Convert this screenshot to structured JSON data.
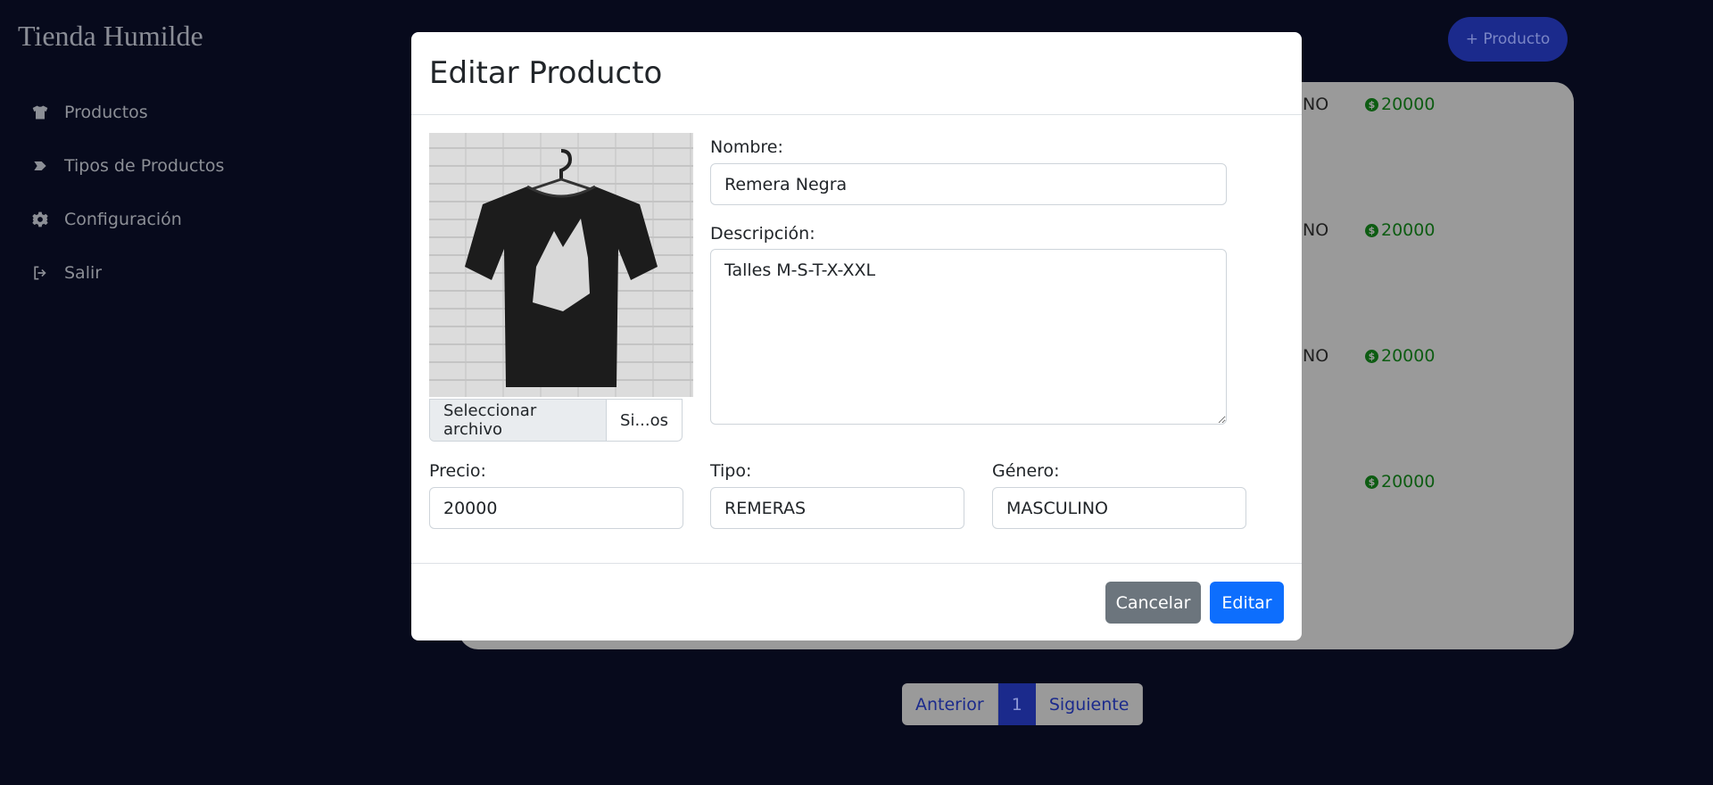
{
  "app": {
    "brand": "Tienda Humilde"
  },
  "sidebar": {
    "items": [
      {
        "label": "Productos",
        "icon": "tshirt-icon"
      },
      {
        "label": "Tipos de Productos",
        "icon": "tag-icon"
      },
      {
        "label": "Configuración",
        "icon": "gear-icon"
      },
      {
        "label": "Salir",
        "icon": "logout-icon"
      }
    ]
  },
  "header": {
    "add_product_label": "+ Producto"
  },
  "table": {
    "rows": [
      {
        "gender_fragment": "NO",
        "price": "20000"
      },
      {
        "gender_fragment": "NO",
        "price": "20000"
      },
      {
        "gender_fragment": "NO",
        "price": "20000"
      },
      {
        "gender_fragment": "",
        "price": "20000"
      }
    ],
    "price_color": "#0d5c12"
  },
  "pagination": {
    "prev": "Anterior",
    "current": "1",
    "next": "Siguiente"
  },
  "modal": {
    "title": "Editar Producto",
    "image_alt": "T-shirt photo",
    "file_button": "Seleccionar archivo",
    "file_name": "Si...os",
    "nombre": {
      "label": "Nombre:",
      "value": "Remera Negra"
    },
    "descripcion": {
      "label": "Descripción:",
      "value": "Talles M-S-T-X-XXL"
    },
    "precio": {
      "label": "Precio:",
      "value": "20000"
    },
    "tipo": {
      "label": "Tipo:",
      "value": "REMERAS"
    },
    "genero": {
      "label": "Género:",
      "value": "MASCULINO"
    },
    "cancel_label": "Cancelar",
    "edit_label": "Editar",
    "colors": {
      "cancel": "#6c757d",
      "primary": "#0d6efd"
    }
  }
}
